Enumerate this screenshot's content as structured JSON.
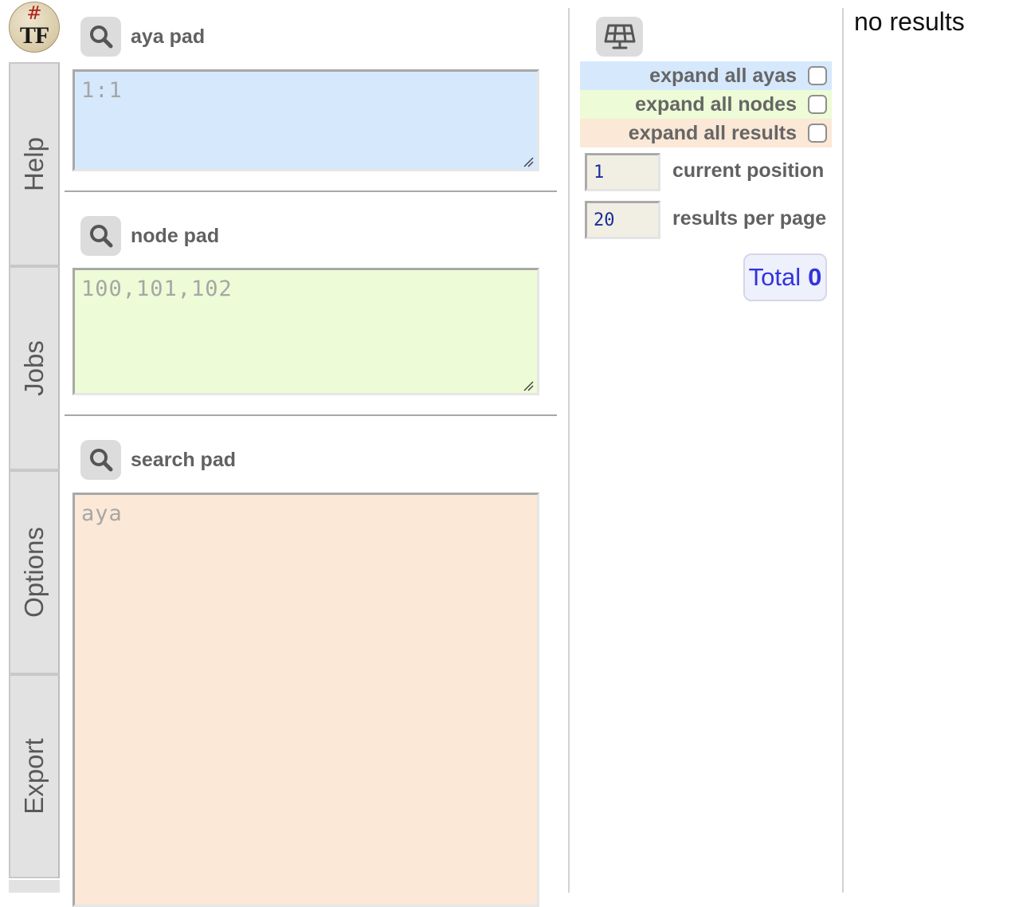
{
  "sidebar": {
    "logo": {
      "hash": "#",
      "text": "TF"
    },
    "tabs": [
      {
        "label": "Help"
      },
      {
        "label": "Jobs"
      },
      {
        "label": "Options"
      },
      {
        "label": "Export"
      }
    ]
  },
  "pads": {
    "aya": {
      "title": "aya pad",
      "placeholder": "1:1",
      "value": ""
    },
    "node": {
      "title": "node pad",
      "placeholder": "100,101,102",
      "value": ""
    },
    "search": {
      "title": "search pad",
      "placeholder": "aya",
      "value": ""
    }
  },
  "options": {
    "settings_icon": "solar-panel-icon",
    "expand_ayas": {
      "label": "expand all ayas",
      "checked": false
    },
    "expand_nodes": {
      "label": "expand all nodes",
      "checked": false
    },
    "expand_results": {
      "label": "expand all results",
      "checked": false
    },
    "position": {
      "value": "1",
      "label": "current position"
    },
    "per_page": {
      "value": "20",
      "label": "results per page"
    },
    "total": {
      "label": "Total",
      "value": "0"
    }
  },
  "results": {
    "message": "no results"
  },
  "colors": {
    "aya_bg": "#d6e8fc",
    "node_bg": "#edfbd6",
    "search_bg": "#fbe8d6",
    "total_text": "#3333dd",
    "number_text": "#1a2d9a"
  }
}
